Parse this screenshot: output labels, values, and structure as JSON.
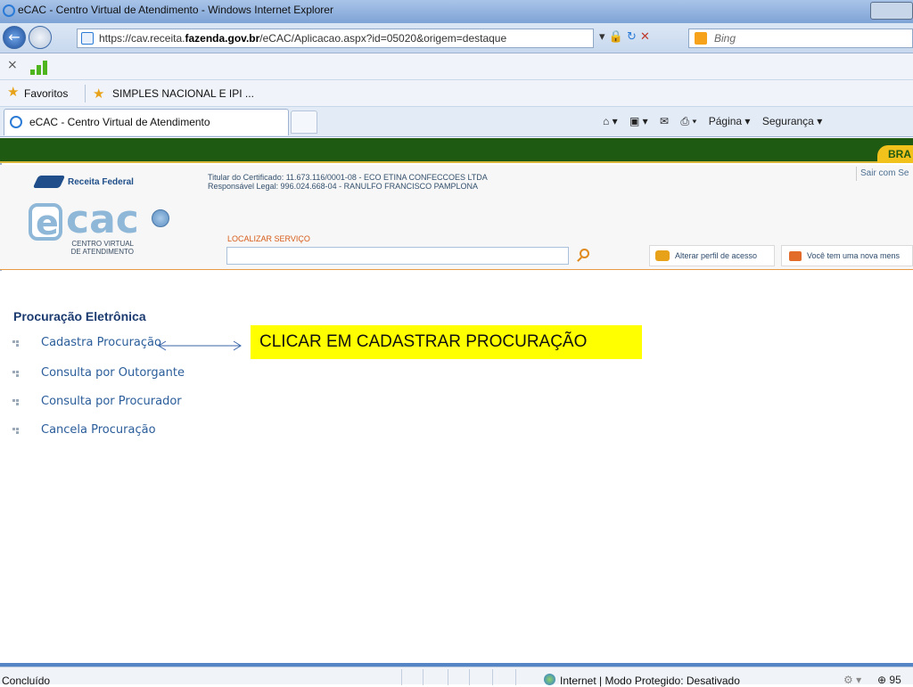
{
  "window": {
    "title": "eCAC - Centro Virtual de Atendimento - Windows Internet Explorer"
  },
  "address": {
    "url_prefix": "https://cav.receita.",
    "url_domain": "fazenda.gov.br",
    "url_rest": "/eCAC/Aplicacao.aspx?id=05020&origem=destaque",
    "search_placeholder": "Bing"
  },
  "favorites": {
    "label": "Favoritos",
    "item": "SIMPLES NACIONAL E IPI ..."
  },
  "tabs": {
    "active": "eCAC - Centro Virtual de Atendimento"
  },
  "tools": {
    "page": "Página ▾",
    "security": "Segurança ▾"
  },
  "banner": {
    "brasil": "BRA"
  },
  "header": {
    "rf_logo": "Receita Federal",
    "cert_line1": "Titular do Certificado: 11.673.116/0001-08 - ECO ETINA CONFECCOES LTDA",
    "cert_line2": "Responsável Legal: 996.024.668-04 - RANULFO FRANCISCO PAMPLONA",
    "logout": "Sair com Se",
    "ecac_e": "e",
    "ecac_cac": "cac",
    "ecac_sub1": "CENTRO VIRTUAL",
    "ecac_sub2": "DE ATENDIMENTO",
    "locate_label": "LOCALIZAR SERVIÇO",
    "locate_value": "",
    "profile_button": "Alterar perfil de acesso",
    "message_button": "Você tem uma nova mens"
  },
  "main": {
    "section_title": "Procuração Eletrônica",
    "items": [
      {
        "label": "Cadastra Procuração"
      },
      {
        "label": "Consulta por Outorgante"
      },
      {
        "label": "Consulta por Procurador"
      },
      {
        "label": "Cancela Procuração"
      }
    ],
    "callout": "CLICAR EM CADASTRAR PROCURAÇÃO"
  },
  "status": {
    "text": "Concluído",
    "zone": "Internet | Modo Protegido: Desativado",
    "zoom": "95"
  },
  "colors": {
    "accent_green": "#1f5a12",
    "link_blue": "#2a5d9a",
    "callout_yellow": "#ffff00"
  }
}
